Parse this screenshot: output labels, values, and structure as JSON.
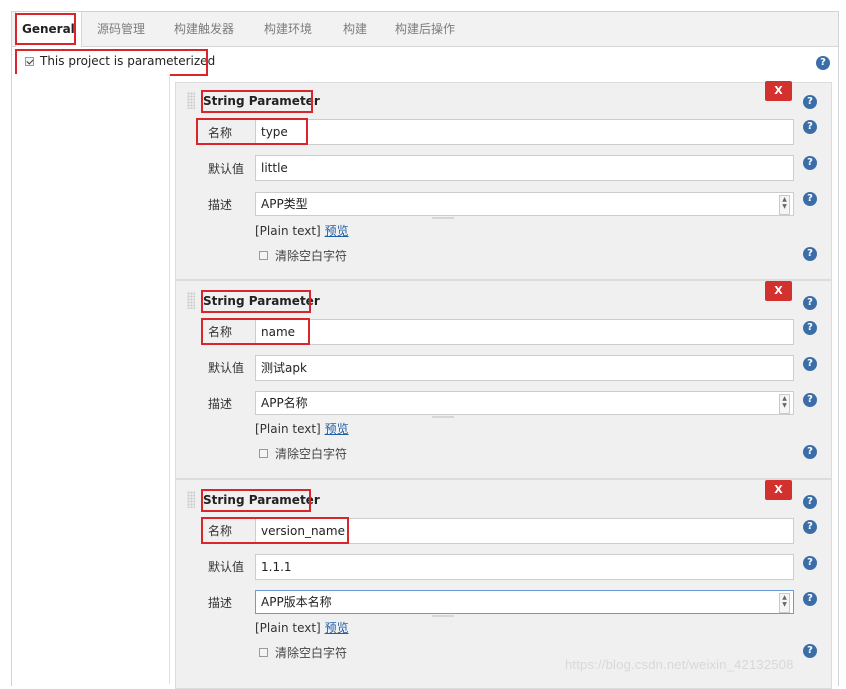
{
  "tabs": [
    {
      "label": "General"
    },
    {
      "label": "源码管理"
    },
    {
      "label": "构建触发器"
    },
    {
      "label": "构建环境"
    },
    {
      "label": "构建"
    },
    {
      "label": "构建后操作"
    }
  ],
  "parameterized": {
    "label": "This project is parameterized",
    "checked": true
  },
  "parameters": [
    {
      "type_label": "String Parameter",
      "delete_label": "X",
      "name_label": "名称",
      "name_value": "type",
      "default_label": "默认值",
      "default_value": "little",
      "desc_label": "描述",
      "desc_value": "APP类型",
      "plain_text": "[Plain text]",
      "preview": "预览",
      "trim_label": "清除空白字符",
      "trim_checked": false
    },
    {
      "type_label": "String Parameter",
      "delete_label": "X",
      "name_label": "名称",
      "name_value": "name",
      "default_label": "默认值",
      "default_value": "测试apk",
      "desc_label": "描述",
      "desc_value": "APP名称",
      "plain_text": "[Plain text]",
      "preview": "预览",
      "trim_label": "清除空白字符",
      "trim_checked": false
    },
    {
      "type_label": "String Parameter",
      "delete_label": "X",
      "name_label": "名称",
      "name_value": "version_name",
      "default_label": "默认值",
      "default_value": "1.1.1",
      "desc_label": "描述",
      "desc_value": "APP版本名称",
      "plain_text": "[Plain text]",
      "preview": "预览",
      "trim_label": "清除空白字符",
      "trim_checked": false
    }
  ],
  "watermark": "https://blog.csdn.net/weixin_42132508",
  "colors": {
    "highlight": "#d9262d",
    "delete": "#d3312e",
    "help": "#3b6ea8",
    "link": "#1f5fa8"
  }
}
